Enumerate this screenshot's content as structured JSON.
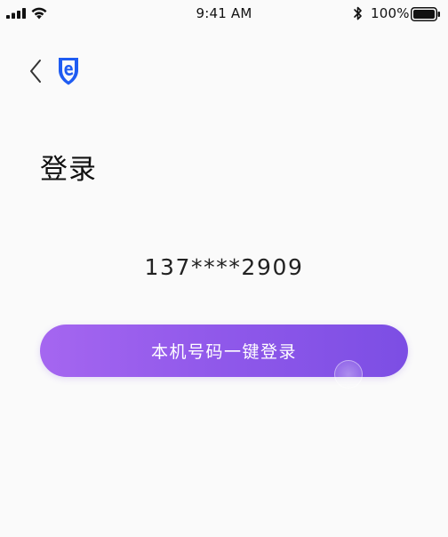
{
  "status_bar": {
    "time": "9:41 AM",
    "battery_percent": "100%",
    "icons": [
      "signal-icon",
      "wifi-icon",
      "bluetooth-icon",
      "battery-icon"
    ]
  },
  "nav": {
    "back_icon": "chevron-left-icon",
    "logo_icon": "shield-e-logo-icon"
  },
  "page": {
    "title": "登录",
    "masked_phone": "137****2909",
    "login_button_label": "本机号码一键登录"
  },
  "colors": {
    "accent_start": "#a566f0",
    "accent_end": "#7c4ee4",
    "logo_blue": "#1f5cf2",
    "background": "#fafafa"
  }
}
